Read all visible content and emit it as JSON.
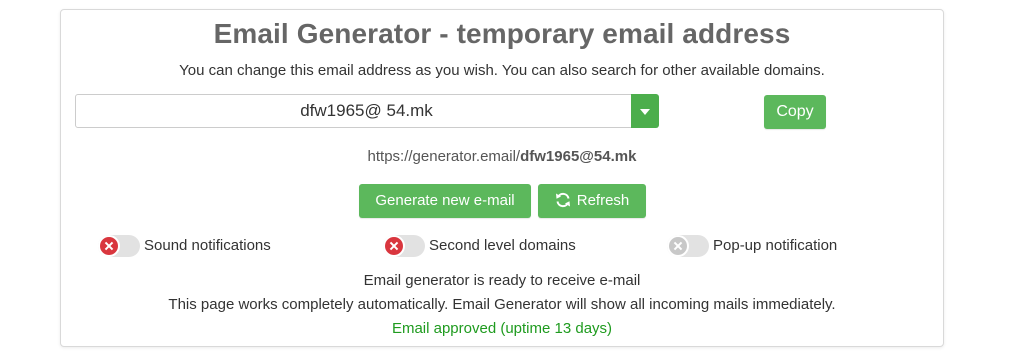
{
  "header": {
    "title": "Email Generator - temporary email address",
    "subtitle": "You can change this email address as you wish. You can also search for other available domains."
  },
  "email": {
    "user": "dfw1965@",
    "domain": "54.mk",
    "link_prefix": "https://generator.email/",
    "link_address": "dfw1965@54.mk"
  },
  "buttons": {
    "copy": "Copy",
    "generate": "Generate new e-mail",
    "refresh": "Refresh"
  },
  "toggles": [
    {
      "label": "Sound notifications",
      "state": "off"
    },
    {
      "label": "Second level domains",
      "state": "off"
    },
    {
      "label": "Pop-up notification",
      "state": "disabled"
    }
  ],
  "status": {
    "ready": "Email generator is ready to receive e-mail",
    "info": "This page works completely automatically. Email Generator will show all incoming mails immediately.",
    "approved": "Email approved (uptime 13 days)"
  },
  "colors": {
    "accent": "#5cb85c",
    "toggle_off": "#d9363e",
    "approved_text": "#1f9b1f"
  },
  "icons": {
    "refresh": "refresh-icon",
    "dropdown": "chevron-down-icon",
    "toggle_off": "close-icon"
  }
}
